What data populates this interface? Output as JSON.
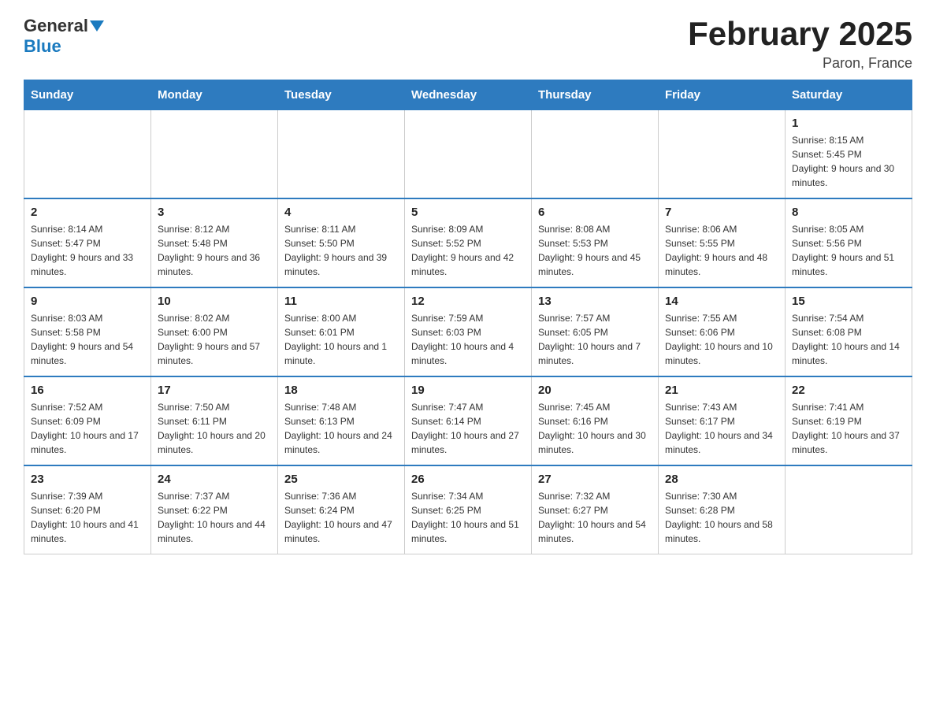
{
  "header": {
    "logo_general": "General",
    "logo_blue": "Blue",
    "month_title": "February 2025",
    "location": "Paron, France"
  },
  "days_of_week": [
    "Sunday",
    "Monday",
    "Tuesday",
    "Wednesday",
    "Thursday",
    "Friday",
    "Saturday"
  ],
  "weeks": [
    [
      {
        "day": "",
        "info": ""
      },
      {
        "day": "",
        "info": ""
      },
      {
        "day": "",
        "info": ""
      },
      {
        "day": "",
        "info": ""
      },
      {
        "day": "",
        "info": ""
      },
      {
        "day": "",
        "info": ""
      },
      {
        "day": "1",
        "info": "Sunrise: 8:15 AM\nSunset: 5:45 PM\nDaylight: 9 hours and 30 minutes."
      }
    ],
    [
      {
        "day": "2",
        "info": "Sunrise: 8:14 AM\nSunset: 5:47 PM\nDaylight: 9 hours and 33 minutes."
      },
      {
        "day": "3",
        "info": "Sunrise: 8:12 AM\nSunset: 5:48 PM\nDaylight: 9 hours and 36 minutes."
      },
      {
        "day": "4",
        "info": "Sunrise: 8:11 AM\nSunset: 5:50 PM\nDaylight: 9 hours and 39 minutes."
      },
      {
        "day": "5",
        "info": "Sunrise: 8:09 AM\nSunset: 5:52 PM\nDaylight: 9 hours and 42 minutes."
      },
      {
        "day": "6",
        "info": "Sunrise: 8:08 AM\nSunset: 5:53 PM\nDaylight: 9 hours and 45 minutes."
      },
      {
        "day": "7",
        "info": "Sunrise: 8:06 AM\nSunset: 5:55 PM\nDaylight: 9 hours and 48 minutes."
      },
      {
        "day": "8",
        "info": "Sunrise: 8:05 AM\nSunset: 5:56 PM\nDaylight: 9 hours and 51 minutes."
      }
    ],
    [
      {
        "day": "9",
        "info": "Sunrise: 8:03 AM\nSunset: 5:58 PM\nDaylight: 9 hours and 54 minutes."
      },
      {
        "day": "10",
        "info": "Sunrise: 8:02 AM\nSunset: 6:00 PM\nDaylight: 9 hours and 57 minutes."
      },
      {
        "day": "11",
        "info": "Sunrise: 8:00 AM\nSunset: 6:01 PM\nDaylight: 10 hours and 1 minute."
      },
      {
        "day": "12",
        "info": "Sunrise: 7:59 AM\nSunset: 6:03 PM\nDaylight: 10 hours and 4 minutes."
      },
      {
        "day": "13",
        "info": "Sunrise: 7:57 AM\nSunset: 6:05 PM\nDaylight: 10 hours and 7 minutes."
      },
      {
        "day": "14",
        "info": "Sunrise: 7:55 AM\nSunset: 6:06 PM\nDaylight: 10 hours and 10 minutes."
      },
      {
        "day": "15",
        "info": "Sunrise: 7:54 AM\nSunset: 6:08 PM\nDaylight: 10 hours and 14 minutes."
      }
    ],
    [
      {
        "day": "16",
        "info": "Sunrise: 7:52 AM\nSunset: 6:09 PM\nDaylight: 10 hours and 17 minutes."
      },
      {
        "day": "17",
        "info": "Sunrise: 7:50 AM\nSunset: 6:11 PM\nDaylight: 10 hours and 20 minutes."
      },
      {
        "day": "18",
        "info": "Sunrise: 7:48 AM\nSunset: 6:13 PM\nDaylight: 10 hours and 24 minutes."
      },
      {
        "day": "19",
        "info": "Sunrise: 7:47 AM\nSunset: 6:14 PM\nDaylight: 10 hours and 27 minutes."
      },
      {
        "day": "20",
        "info": "Sunrise: 7:45 AM\nSunset: 6:16 PM\nDaylight: 10 hours and 30 minutes."
      },
      {
        "day": "21",
        "info": "Sunrise: 7:43 AM\nSunset: 6:17 PM\nDaylight: 10 hours and 34 minutes."
      },
      {
        "day": "22",
        "info": "Sunrise: 7:41 AM\nSunset: 6:19 PM\nDaylight: 10 hours and 37 minutes."
      }
    ],
    [
      {
        "day": "23",
        "info": "Sunrise: 7:39 AM\nSunset: 6:20 PM\nDaylight: 10 hours and 41 minutes."
      },
      {
        "day": "24",
        "info": "Sunrise: 7:37 AM\nSunset: 6:22 PM\nDaylight: 10 hours and 44 minutes."
      },
      {
        "day": "25",
        "info": "Sunrise: 7:36 AM\nSunset: 6:24 PM\nDaylight: 10 hours and 47 minutes."
      },
      {
        "day": "26",
        "info": "Sunrise: 7:34 AM\nSunset: 6:25 PM\nDaylight: 10 hours and 51 minutes."
      },
      {
        "day": "27",
        "info": "Sunrise: 7:32 AM\nSunset: 6:27 PM\nDaylight: 10 hours and 54 minutes."
      },
      {
        "day": "28",
        "info": "Sunrise: 7:30 AM\nSunset: 6:28 PM\nDaylight: 10 hours and 58 minutes."
      },
      {
        "day": "",
        "info": ""
      }
    ]
  ]
}
